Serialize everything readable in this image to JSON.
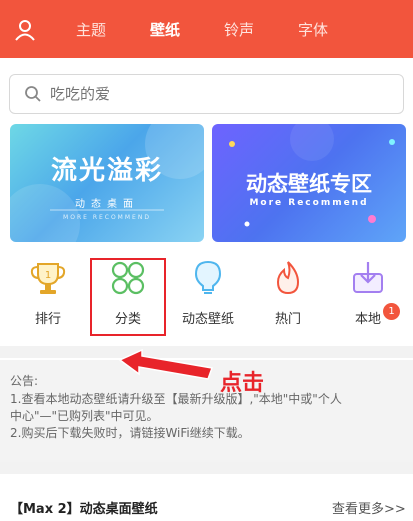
{
  "topnav": {
    "tabs": [
      "主题",
      "壁纸",
      "铃声",
      "字体"
    ],
    "active_index": 1
  },
  "search": {
    "placeholder": "吃吃的爱"
  },
  "banners": {
    "left": {
      "title": "流光溢彩",
      "subtitle": "动态桌面",
      "caption": "MORE RECOMMEND"
    },
    "right": {
      "title": "动态壁纸专区",
      "subtitle": "More Recommend"
    }
  },
  "categories": [
    {
      "label": "排行",
      "icon": "trophy-icon"
    },
    {
      "label": "分类",
      "icon": "grid-circles-icon"
    },
    {
      "label": "动态壁纸",
      "icon": "bulb-icon"
    },
    {
      "label": "热门",
      "icon": "flame-icon"
    },
    {
      "label": "本地",
      "icon": "download-box-icon",
      "badge": "1"
    }
  ],
  "annotation": {
    "text": "点击"
  },
  "notice": {
    "label": "公告:",
    "lines": [
      "1.查看本地动态壁纸请升级至【最新升级版】,\"本地\"中或\"个人",
      "中心\"—\"已购列表\"中可见。",
      "2.购买后下载失败时，请链接WiFi继续下载。"
    ]
  },
  "section": {
    "title": "【Max 2】动态桌面壁纸",
    "more": "查看更多>>"
  },
  "colors": {
    "brand": "#f2553d",
    "highlight": "#e8242a"
  }
}
